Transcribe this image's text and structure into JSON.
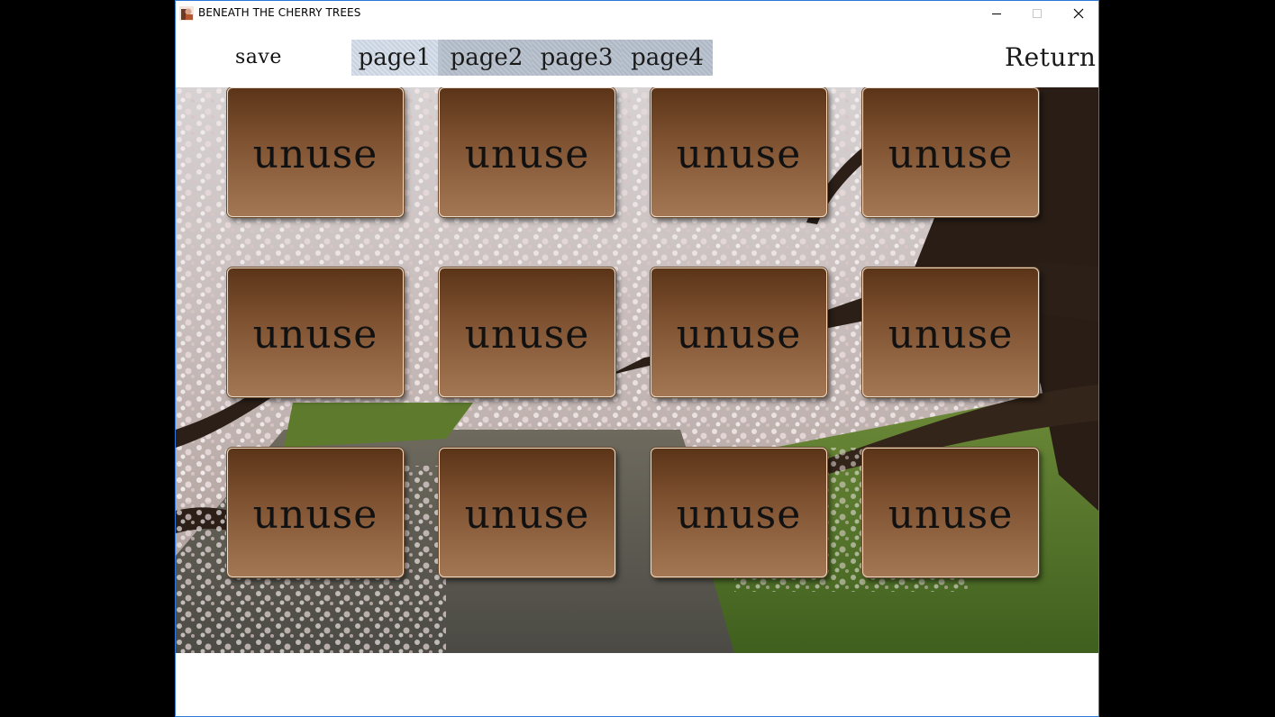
{
  "window": {
    "title": "BENEATH THE CHERRY TREES"
  },
  "menu": {
    "save_label": "save",
    "tabs": [
      {
        "label": "page1",
        "active": true
      },
      {
        "label": "page2",
        "active": false
      },
      {
        "label": "page3",
        "active": false
      },
      {
        "label": "page4",
        "active": false
      }
    ],
    "return_label": "Return"
  },
  "slots": [
    {
      "label": "unuse"
    },
    {
      "label": "unuse"
    },
    {
      "label": "unuse"
    },
    {
      "label": "unuse"
    },
    {
      "label": "unuse"
    },
    {
      "label": "unuse"
    },
    {
      "label": "unuse"
    },
    {
      "label": "unuse"
    },
    {
      "label": "unuse"
    },
    {
      "label": "unuse"
    },
    {
      "label": "unuse"
    },
    {
      "label": "unuse"
    }
  ],
  "colors": {
    "window_border": "#2b78d6",
    "slot_top": "#5b3418",
    "slot_bottom": "#a47754"
  }
}
